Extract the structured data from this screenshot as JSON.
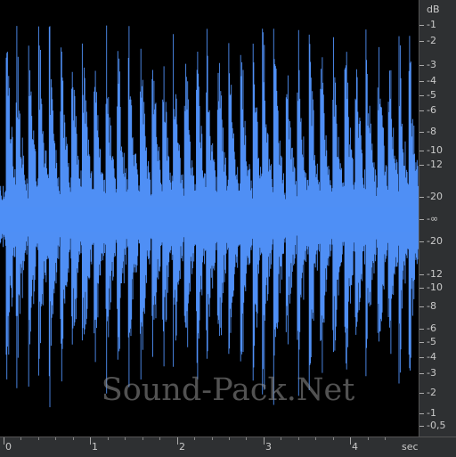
{
  "colors": {
    "waveform": "#4f8ff5",
    "background": "#000000",
    "ruler": "#2e3032"
  },
  "watermark": "Sound-Pack.Net",
  "db_scale": {
    "unit": "dB",
    "upper_labels": [
      "-1",
      "-2",
      "-3",
      "-4",
      "-5",
      "-6",
      "-8",
      "-10",
      "-12",
      "-20"
    ],
    "center_label": "-∞",
    "lower_labels": [
      "-20",
      "-12",
      "-10",
      "-8",
      "-6",
      "-5",
      "-4",
      "-3",
      "-2",
      "-1",
      "-0,5"
    ]
  },
  "time_scale": {
    "unit": "sec",
    "labels": [
      "0",
      "1",
      "2",
      "3",
      "4"
    ]
  }
}
